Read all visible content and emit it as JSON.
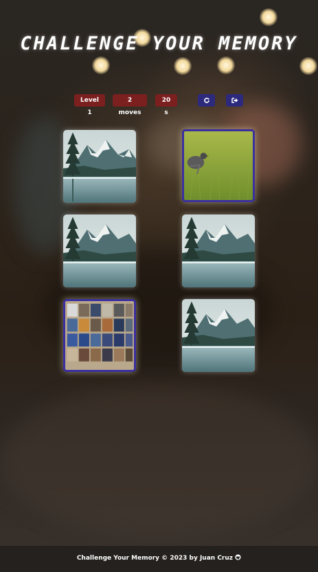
{
  "title": "CHALLENGE YOUR MEMORY",
  "stats": {
    "level": "Level 1",
    "moves": "2 moves",
    "time": "20 s"
  },
  "buttons": {
    "restart_icon": "refresh-icon",
    "exit_icon": "sign-out-icon"
  },
  "cards": [
    {
      "image": "mountain-lake",
      "state": "revealed"
    },
    {
      "image": "bird-in-grass",
      "state": "selected"
    },
    {
      "image": "mountain-lake",
      "state": "revealed"
    },
    {
      "image": "mountain-lake",
      "state": "revealed"
    },
    {
      "image": "movie-shelf",
      "state": "selected"
    },
    {
      "image": "mountain-lake",
      "state": "revealed"
    }
  ],
  "footer": {
    "text": "Challenge Your Memory © 2023 by Juan Cruz",
    "icon": "github-icon"
  },
  "colors": {
    "stat_pill": "#7b1f1f",
    "icon_button": "#2d2a7e",
    "selected_border": "#3a2fa0"
  }
}
